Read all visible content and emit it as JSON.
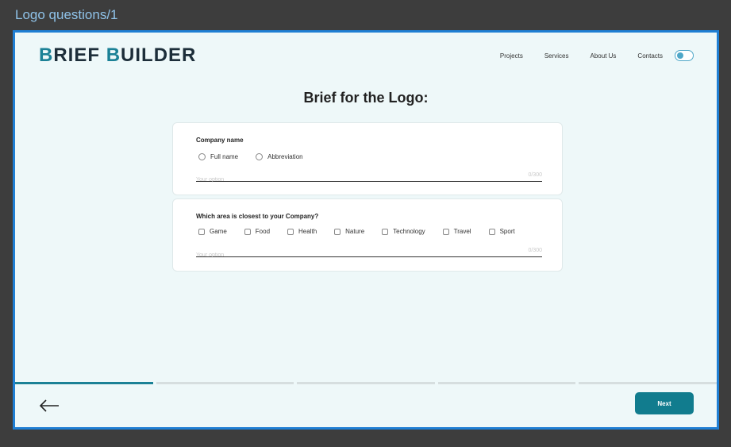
{
  "frame_title": "Logo questions/1",
  "brand": {
    "part1_initial": "B",
    "part1_rest": "RIEF ",
    "part2_initial": "B",
    "part2_rest": "UILDER"
  },
  "nav": {
    "items": [
      "Projects",
      "Services",
      "About Us",
      "Contacts"
    ]
  },
  "theme_toggle": {
    "on": true
  },
  "page_title": "Brief for the Logo:",
  "questions": [
    {
      "label": "Company name",
      "type": "radio",
      "options": [
        "Full name",
        "Abbreviation"
      ],
      "input_placeholder": "Your option",
      "counter": "0/300"
    },
    {
      "label": "Which area is closest to your Company?",
      "type": "checkbox",
      "options": [
        "Game",
        "Food",
        "Health",
        "Nature",
        "Technology",
        "Travel",
        "Sport"
      ],
      "input_placeholder": "Your option",
      "counter": "0/300"
    }
  ],
  "progress": {
    "steps": 5,
    "current": 1
  },
  "footer": {
    "next_label": "Next"
  },
  "colors": {
    "accent": "#117c8e",
    "frame_border": "#1f7fd4",
    "page_bg": "#eef8f9"
  }
}
